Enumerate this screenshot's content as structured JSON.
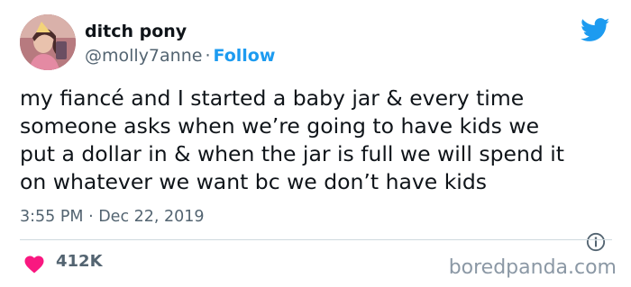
{
  "user": {
    "display_name": "ditch pony",
    "handle": "@molly7anne",
    "separator": "·",
    "follow_label": "Follow"
  },
  "tweet": {
    "text": "my fiancé and I started a baby jar & every time\nsomeone asks when we’re going to have kids we\nput a dollar in & when the jar is full we will spend it\non whatever we want bc we don’t have kids",
    "timestamp": "3:55 PM · Dec 22, 2019",
    "likes": "412K"
  },
  "watermark": "boredpanda.com",
  "colors": {
    "accent": "#1d9bf0",
    "heart": "#f91880",
    "muted_text": "#536471",
    "text": "#0f1419",
    "divider": "#cfd9de"
  },
  "icons": {
    "brand": "twitter-bird-icon",
    "info": "info-icon",
    "like": "heart-icon"
  }
}
